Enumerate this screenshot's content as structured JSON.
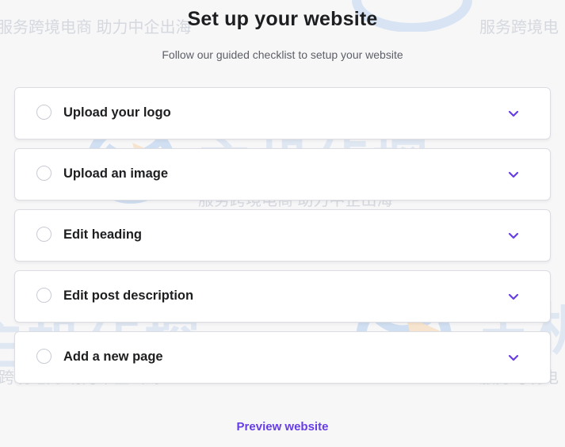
{
  "header": {
    "title": "Set up your website",
    "subtitle": "Follow our guided checklist to setup your website"
  },
  "checklist": {
    "items": [
      {
        "label": "Upload your logo",
        "completed": false
      },
      {
        "label": "Upload an image",
        "completed": false
      },
      {
        "label": "Edit heading",
        "completed": false
      },
      {
        "label": "Edit post description",
        "completed": false
      },
      {
        "label": "Add a new page",
        "completed": false
      }
    ]
  },
  "footer": {
    "preview_label": "Preview website"
  },
  "watermark": {
    "brand_text": "主机侦探",
    "tagline": "服务跨境电商 助力中企出海",
    "tagline_right": "服务跨境电",
    "tagline_left": "跨境电商 助力中企出海",
    "tagline_top_right": "服务跨境电"
  },
  "colors": {
    "accent": "#673de6",
    "text": "#1d1e20",
    "muted": "#5c5f66",
    "card_border": "#dcdde3",
    "background": "#f7f7f8"
  },
  "icons": {
    "item_status": "empty-circle-icon",
    "item_toggle": "chevron-down-icon"
  }
}
